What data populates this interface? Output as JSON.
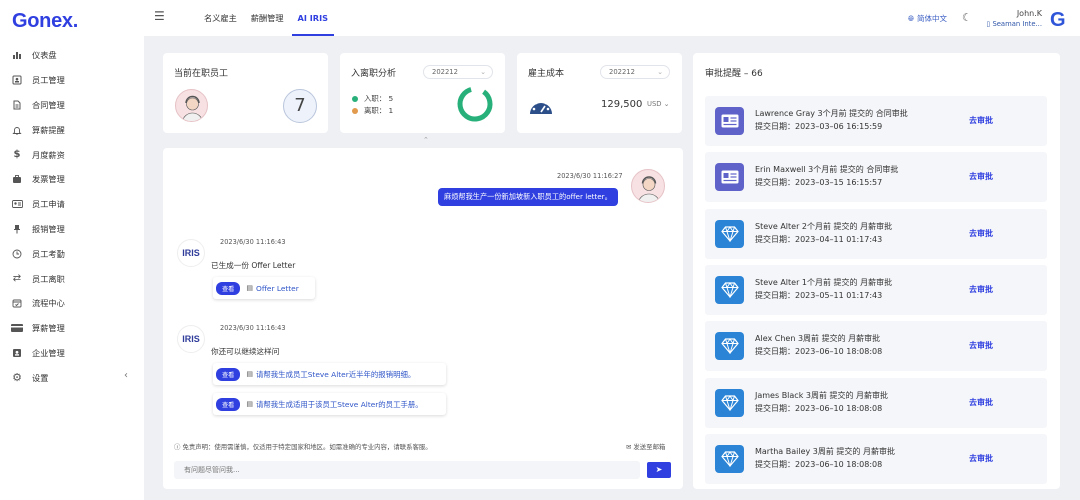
{
  "brand": {
    "logo": "Gonex."
  },
  "sidebar": {
    "items": [
      {
        "label": "仪表盘",
        "icon": "bar-chart-icon"
      },
      {
        "label": "员工管理",
        "icon": "id-card-icon"
      },
      {
        "label": "合同管理",
        "icon": "document-icon"
      },
      {
        "label": "算薪提醒",
        "icon": "bell-icon"
      },
      {
        "label": "月度薪资",
        "icon": "dollar-icon"
      },
      {
        "label": "发票管理",
        "icon": "briefcase-icon"
      },
      {
        "label": "员工申请",
        "icon": "badge-icon"
      },
      {
        "label": "报销管理",
        "icon": "pin-icon"
      },
      {
        "label": "员工考勤",
        "icon": "clock-icon"
      },
      {
        "label": "员工离职",
        "icon": "exchange-icon"
      },
      {
        "label": "流程中心",
        "icon": "calendar-check-icon"
      },
      {
        "label": "算薪管理",
        "icon": "card-icon"
      },
      {
        "label": "企业管理",
        "icon": "contact-icon"
      },
      {
        "label": "设置",
        "icon": "gear-icon"
      }
    ],
    "collapse": "‹"
  },
  "header": {
    "tabs": [
      {
        "label": "名义雇主",
        "active": false
      },
      {
        "label": "薪酬管理",
        "active": false
      },
      {
        "label": "AI IRIS",
        "active": true
      }
    ],
    "language": "简体中文",
    "user_name": "John.K",
    "company": "Seaman Inte...",
    "account_badge": "G"
  },
  "stats": {
    "employees": {
      "title": "当前在职员工",
      "count": "7"
    },
    "turnover": {
      "title": "入离职分析",
      "period": "202212",
      "onboard_label": "入职：",
      "onboard_value": "5",
      "offboard_label": "离职：",
      "offboard_value": "1",
      "colors": {
        "onboard": "#27b07a",
        "offboard": "#e29a4d"
      }
    },
    "cost": {
      "title": "雇主成本",
      "period": "202212",
      "amount": "129,500",
      "currency": "USD"
    }
  },
  "chat": {
    "user_msg": {
      "time": "2023/6/30 11:16:27",
      "text": "麻烦帮我生产一份新加坡新入职员工的offer letter。"
    },
    "replies": [
      {
        "time": "2023/6/30 11:16:43",
        "text": "已生成一份 Offer Letter",
        "options": [
          {
            "button": "查看",
            "text": "Offer Letter"
          }
        ]
      },
      {
        "time": "2023/6/30 11:16:43",
        "text": "你还可以继续这样问",
        "options": [
          {
            "button": "查看",
            "text": "请帮我生成员工Steve Alter近半年的报销明细。"
          },
          {
            "button": "查看",
            "text": "请帮我生成适用于该员工Steve Alter的员工手册。"
          }
        ]
      }
    ],
    "bot_logo": "IRIS",
    "disclaimer": "免责声明：使用需谨慎，仅适用于特定国家和地区。如需准确的专业内容，请联系客服。",
    "send_mail": "发送至邮箱",
    "input_placeholder": "有问题尽管问我..."
  },
  "approvals": {
    "title": "审批提醒 – 66",
    "action_label": "去审批",
    "items": [
      {
        "line1": "Lawrence Gray 3个月前 提交的 合同审批",
        "line2": "提交日期：2023–03–06 16:15:59",
        "icon": "contract-card-icon"
      },
      {
        "line1": "Erin Maxwell 3个月前 提交的 合同审批",
        "line2": "提交日期：2023–03–15 16:15:57",
        "icon": "contract-card-icon"
      },
      {
        "line1": "Steve Alter 2个月前 提交的 月薪审批",
        "line2": "提交日期：2023–04–11 01:17:43",
        "icon": "diamond-icon"
      },
      {
        "line1": "Steve Alter 1个月前 提交的 月薪审批",
        "line2": "提交日期：2023–05–11 01:17:43",
        "icon": "diamond-icon"
      },
      {
        "line1": "Alex Chen 3周前 提交的 月薪审批",
        "line2": "提交日期：2023–06–10 18:08:08",
        "icon": "diamond-icon"
      },
      {
        "line1": "James Black 3周前 提交的 月薪审批",
        "line2": "提交日期：2023–06–10 18:08:08",
        "icon": "diamond-icon"
      },
      {
        "line1": "Martha Bailey 3周前 提交的 月薪审批",
        "line2": "提交日期：2023–06–10 18:08:08",
        "icon": "diamond-icon"
      }
    ],
    "colors": {
      "contract": "#5f63c9",
      "salary": "#2b84d6"
    }
  },
  "colors": {
    "accent": "#2f3fe0"
  }
}
